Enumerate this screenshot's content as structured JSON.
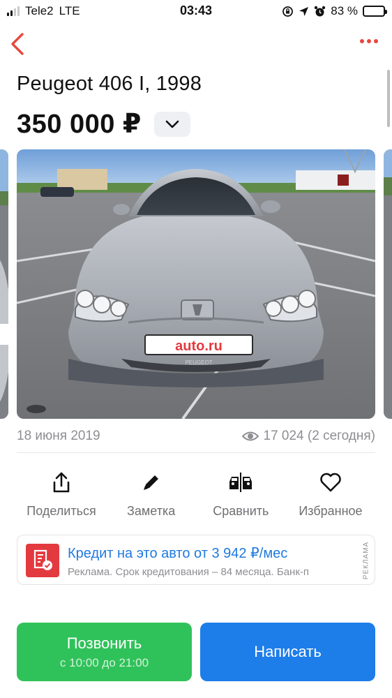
{
  "status_bar": {
    "carrier": "Tele2",
    "network": "LTE",
    "time": "03:43",
    "battery_percent": "83 %",
    "battery_level": 0.83
  },
  "nav": {
    "back_icon": "chevron-left-icon",
    "more_icon": "ellipsis-icon",
    "accent_color": "#e8473d"
  },
  "listing": {
    "title": "Peugeot 406 I, 1998",
    "price": "350 000 ₽",
    "date": "18 июня 2019",
    "views": "17 024 (2 сегодня)",
    "photo_plate_text": "auto.ru",
    "photo_badge_text": "PEUGEOT"
  },
  "actions": [
    {
      "label": "Поделиться",
      "icon": "share-icon"
    },
    {
      "label": "Заметка",
      "icon": "pencil-icon"
    },
    {
      "label": "Сравнить",
      "icon": "compare-cars-icon"
    },
    {
      "label": "Избранное",
      "icon": "heart-icon"
    }
  ],
  "ad": {
    "title": "Кредит на это авто от 3 942 ₽/мес",
    "subtitle": "Реклама. Срок кредитования – 84 месяца. Банк-п",
    "tag": "РЕКЛАМА",
    "icon": "credit-document-icon"
  },
  "buttons": {
    "call_label": "Позвонить",
    "call_hours": "с 10:00 до 21:00",
    "write_label": "Написать",
    "call_color": "#30c25a",
    "write_color": "#1d7de9"
  }
}
